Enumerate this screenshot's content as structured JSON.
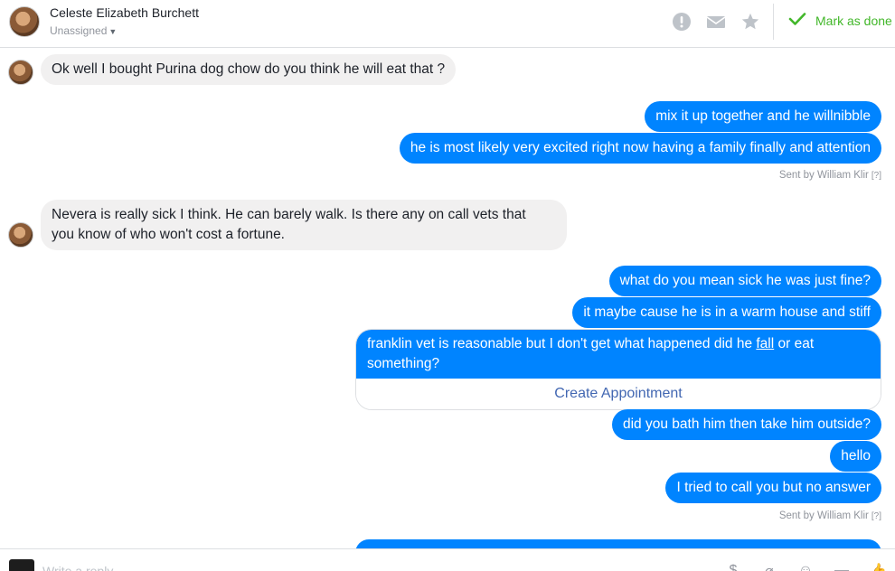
{
  "header": {
    "contact_name": "Celeste Elizabeth Burchett",
    "assignment": "Unassigned",
    "mark_done_label": "Mark as done",
    "icons": [
      "alert-icon",
      "mail-icon",
      "star-icon",
      "checkmark-icon"
    ]
  },
  "messages": {
    "m1": "Ok well I bought Purina dog chow do you think he will eat that ?",
    "m2": "mix it up together and he willnibble",
    "m3": "he is most likely very excited right now having a family finally and attention",
    "sent_by_1": "Sent by William Klir",
    "m4_line1": "Nevera is really sick I think. He can barely walk. Is there any on call vets that",
    "m4_line2": "you know of who won't cost a fortune.",
    "m5": "what do you mean sick he was just fine?",
    "m6": "it maybe cause he is in a warm house and stiff",
    "m7_before": "franklin vet is reasonable but I don't get what happened did he ",
    "m7_link": "fall",
    "m7_after": " or eat something?",
    "m7_action": "Create Appointment",
    "m8": "did you bath him then take him outside?",
    "m9": "hello",
    "m10": "I tried to call you but no answer",
    "sent_by_2": "Sent by William Klir",
    "help_marker": "[?]"
  },
  "composer": {
    "placeholder": "Write a reply...",
    "icons": [
      "dollar-icon",
      "attachment-icon",
      "emoji-icon",
      "saved-reply-icon",
      "like-icon"
    ]
  },
  "colors": {
    "outgoing": "#0084ff",
    "incoming": "#f1f0f0",
    "done_green": "#42b72a",
    "link_blue": "#4267b2"
  }
}
